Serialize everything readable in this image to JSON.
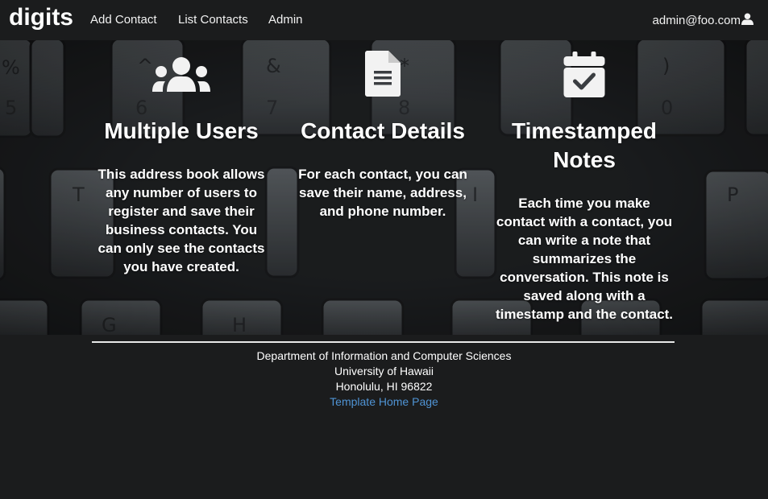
{
  "navbar": {
    "brand": "digits",
    "items": [
      {
        "label": "Add Contact"
      },
      {
        "label": "List Contacts"
      },
      {
        "label": "Admin"
      }
    ],
    "user": "admin@foo.com"
  },
  "features": [
    {
      "icon": "users-icon",
      "title": "Multiple Users",
      "text": "This address book allows any number of users to register and save their business contacts. You can only see the contacts you have created."
    },
    {
      "icon": "file-text-icon",
      "title": "Contact Details",
      "text": "For each contact, you can save their name, address, and phone number."
    },
    {
      "icon": "calendar-check-icon",
      "title": "Timestamped Notes",
      "text": "Each time you make contact with a contact, you can write a note that summarizes the conversation. This note is saved along with a timestamp and the contact."
    }
  ],
  "footer": {
    "line1": "Department of Information and Computer Sciences",
    "line2": "University of Hawaii",
    "line3": "Honolulu, HI 96822",
    "link": "Template Home Page"
  },
  "colors": {
    "navbar_bg": "#1b1c1d",
    "link": "#4f93d4",
    "text": "#ffffff"
  }
}
